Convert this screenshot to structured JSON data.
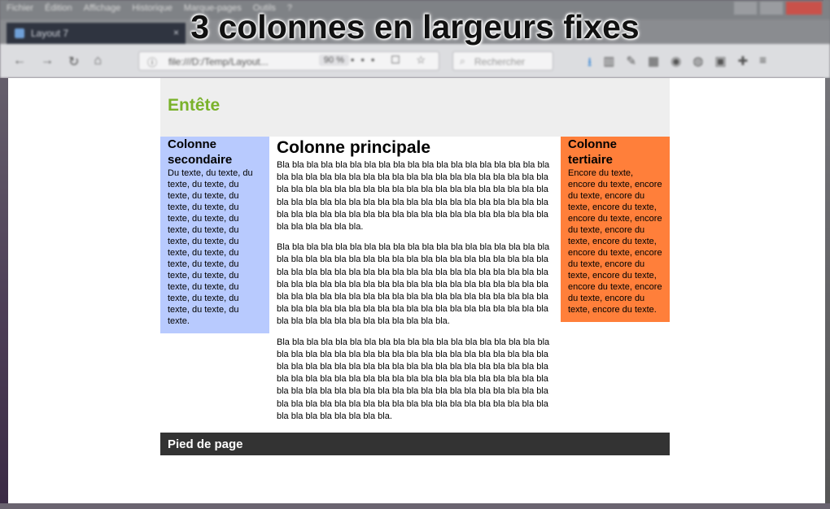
{
  "overlay": {
    "title": "3 colonnes en largeurs fixes"
  },
  "browser": {
    "menu": [
      "Fichier",
      "Édition",
      "Affichage",
      "Historique",
      "Marque-pages",
      "Outils",
      "?"
    ],
    "tab_title": "Layout 7",
    "tab_close": "×",
    "url": "file:///D:/Temp/Layout...",
    "zoom": "90 %",
    "url_extras": "••• ☐ ☆",
    "search_placeholder": "Rechercher"
  },
  "page": {
    "header_title": "Entête",
    "secondary": {
      "title": "Colonne secondaire",
      "text": "Du texte, du texte, du texte, du texte, du texte, du texte, du texte, du texte, du texte, du texte, du texte, du texte, du texte, du texte, du texte, du texte, du texte, du texte, du texte, du texte, du texte, du texte, du texte, du texte, du texte, du texte, du texte."
    },
    "main": {
      "title": "Colonne principale",
      "paragraphs": [
        "Bla bla bla bla bla bla bla bla bla bla bla bla bla bla bla bla bla bla bla bla bla bla bla bla bla bla bla bla bla bla bla bla bla bla bla bla bla bla bla bla bla bla bla bla bla bla bla bla bla bla bla bla bla bla bla bla bla bla bla bla bla bla bla bla bla bla bla bla bla bla bla bla bla bla bla bla bla bla bla bla bla bla bla bla bla bla bla bla bla bla bla bla bla bla bla bla bla bla bla bla bla.",
        "Bla bla bla bla bla bla bla bla bla bla bla bla bla bla bla bla bla bla bla bla bla bla bla bla bla bla bla bla bla bla bla bla bla bla bla bla bla bla bla bla bla bla bla bla bla bla bla bla bla bla bla bla bla bla bla bla bla bla bla bla bla bla bla bla bla bla bla bla bla bla bla bla bla bla bla bla bla bla bla bla bla bla bla bla bla bla bla bla bla bla bla bla bla bla bla bla bla bla bla bla bla bla bla bla bla bla bla bla bla bla bla bla bla bla bla bla bla bla bla bla bla bla bla bla bla bla.",
        "Bla bla bla bla bla bla bla bla bla bla bla bla bla bla bla bla bla bla bla bla bla bla bla bla bla bla bla bla bla bla bla bla bla bla bla bla bla bla bla bla bla bla bla bla bla bla bla bla bla bla bla bla bla bla bla bla bla bla bla bla bla bla bla bla bla bla bla bla bla bla bla bla bla bla bla bla bla bla bla bla bla bla bla bla bla bla bla bla bla bla bla bla bla bla bla bla bla bla bla bla bla bla bla bla bla bla bla bla bla bla bla bla bla bla bla bla bla bla bla bla bla bla."
      ]
    },
    "tertiary": {
      "title": "Colonne tertiaire",
      "text": "Encore du texte, encore du texte, encore du texte, encore du texte, encore du texte, encore du texte, encore du texte, encore du texte, encore du texte, encore du texte, encore du texte, encore du texte, encore du texte, encore du texte, encore du texte, encore du texte, encore du texte."
    },
    "footer": "Pied de page"
  },
  "colors": {
    "header_title": "#7ab22b",
    "secondary_bg": "#b8cafe",
    "tertiary_bg": "#ff7f3a",
    "footer_bg": "#333333",
    "header_bg": "#eeeeee"
  }
}
